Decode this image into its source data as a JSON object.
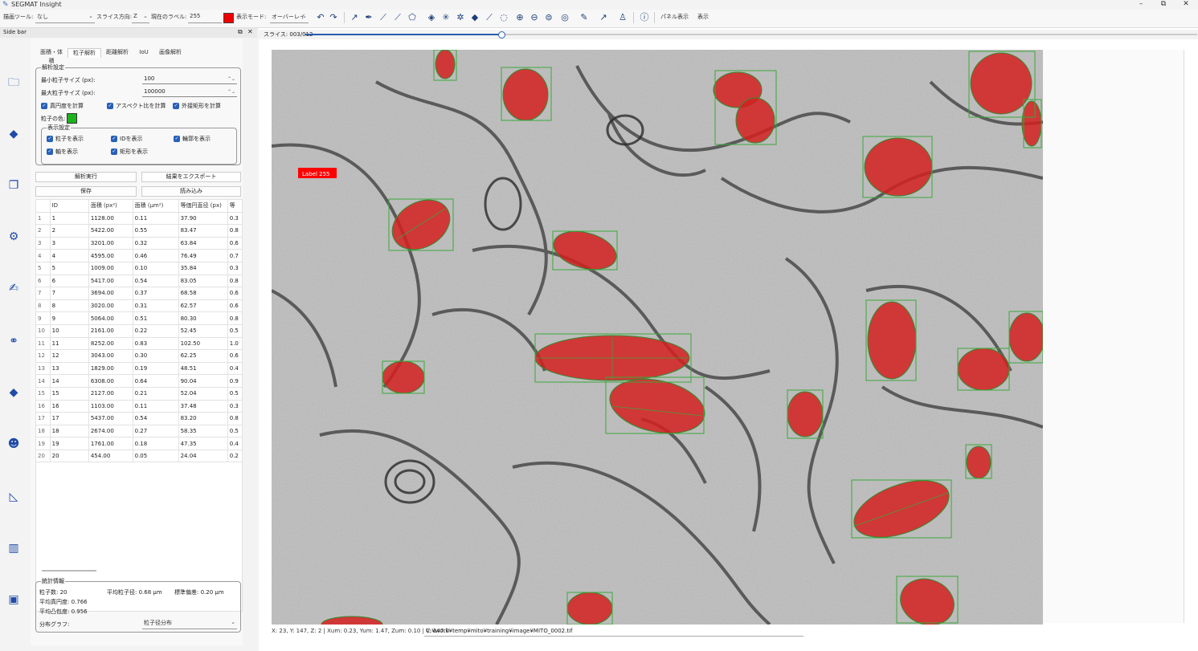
{
  "app": {
    "title": "SEGMAT Insight"
  },
  "window_controls": {
    "minimize": "–",
    "maximize": "⧉",
    "close": "✕"
  },
  "toolbar": {
    "tool_label": "描画ツール:",
    "tool_value": "なし",
    "slice_dir_label": "スライス方向:",
    "slice_dir_value": "Z",
    "label_sel_label": "現在のラベル:",
    "label_value": "255",
    "display_mode_label": "表示モード:",
    "display_mode_value": "オーバーレイ",
    "pan_label": "パネル表示",
    "reset_label": "表示"
  },
  "sidebar": {
    "title": "Side bar",
    "tabs": [
      "面積・体積",
      "粒子解析",
      "距離解析",
      "IoU",
      "画像解析"
    ],
    "active_tab": 1,
    "analysis_group": "解析設定",
    "min_size_label": "最小粒子サイズ (px):",
    "min_size_value": "100",
    "max_size_label": "最大粒子サイズ (px):",
    "max_size_value": "100000",
    "checks1": [
      "真円度を計算",
      "アスペクト比を計算",
      "外接矩形を計算"
    ],
    "particle_color_label": "粒子の色:",
    "display_group": "表示設定",
    "checks2": [
      "粒子を表示",
      "IDを表示",
      "輪郭を表示",
      "軸を表示",
      "矩形を表示"
    ],
    "buttons": [
      "解析実行",
      "結果をエクスポート",
      "保存",
      "読み込み"
    ]
  },
  "table": {
    "headers": [
      "",
      "ID",
      "面積 (px²)",
      "面積 (μm²)",
      "等価円直径 (px)",
      "等"
    ],
    "rows": [
      [
        "1",
        "1",
        "1128.00",
        "0.11",
        "37.90",
        "0.3"
      ],
      [
        "2",
        "2",
        "5422.00",
        "0.55",
        "83.47",
        "0.8"
      ],
      [
        "3",
        "3",
        "3201.00",
        "0.32",
        "63.84",
        "0.6"
      ],
      [
        "4",
        "4",
        "4595.00",
        "0.46",
        "76.49",
        "0.7"
      ],
      [
        "5",
        "5",
        "1009.00",
        "0.10",
        "35.84",
        "0.3"
      ],
      [
        "6",
        "6",
        "5417.00",
        "0.54",
        "83.05",
        "0.8"
      ],
      [
        "7",
        "7",
        "3694.00",
        "0.37",
        "68.58",
        "0.6"
      ],
      [
        "8",
        "8",
        "3020.00",
        "0.31",
        "62.57",
        "0.6"
      ],
      [
        "9",
        "9",
        "5064.00",
        "0.51",
        "80.30",
        "0.8"
      ],
      [
        "10",
        "10",
        "2161.00",
        "0.22",
        "52.45",
        "0.5"
      ],
      [
        "11",
        "11",
        "8252.00",
        "0.83",
        "102.50",
        "1.0"
      ],
      [
        "12",
        "12",
        "3043.00",
        "0.30",
        "62.25",
        "0.6"
      ],
      [
        "13",
        "13",
        "1829.00",
        "0.19",
        "48.51",
        "0.4"
      ],
      [
        "14",
        "14",
        "6308.00",
        "0.64",
        "90.04",
        "0.9"
      ],
      [
        "15",
        "15",
        "2127.00",
        "0.21",
        "52.04",
        "0.5"
      ],
      [
        "16",
        "16",
        "1103.00",
        "0.11",
        "37.48",
        "0.3"
      ],
      [
        "17",
        "17",
        "5437.00",
        "0.54",
        "83.20",
        "0.8"
      ],
      [
        "18",
        "18",
        "2674.00",
        "0.27",
        "58.35",
        "0.5"
      ],
      [
        "19",
        "19",
        "1761.00",
        "0.18",
        "47.35",
        "0.4"
      ],
      [
        "20",
        "20",
        "454.00",
        "0.05",
        "24.04",
        "0.2"
      ]
    ]
  },
  "stats": {
    "group": "統計情報",
    "count": "粒子数: 20",
    "mean_size": "平均粒子径: 0.68 μm",
    "std": "標準偏差: 0.20 μm",
    "circularity": "平均真円度: 0.766",
    "solidity": "平均凸包度: 0.956",
    "dist_label": "分布グラフ:",
    "dist_value": "粒子径分布"
  },
  "viewer": {
    "slice_label": "スライス: 003/012",
    "slice_progress": 0.22,
    "label_tag": "Label 255",
    "status": "X: 23, Y: 147, Z: 2 | Xum: 0.23, Yum: 1.47, Zum: 0.10 | V: 147.0",
    "path": "C:¥work¥temp¥mito¥training¥image¥MITO_0002.tif"
  },
  "colors": {
    "accent": "#2a5db0",
    "particle": "#d42020",
    "bbox": "#3aa83a"
  }
}
